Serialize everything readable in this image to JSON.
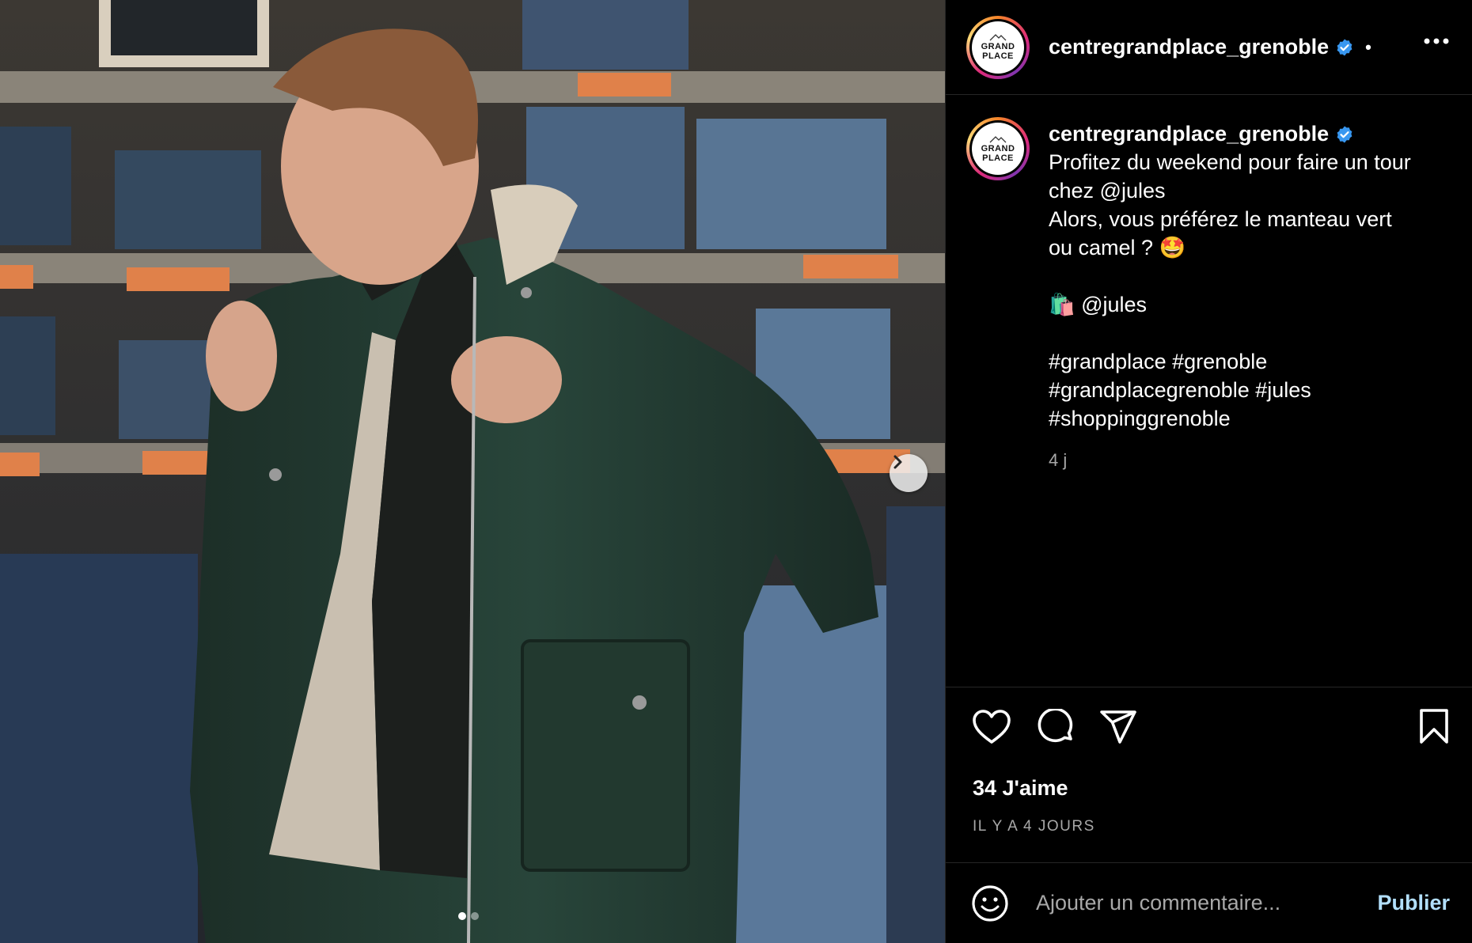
{
  "post": {
    "username": "centregrandplace_grenoble",
    "separator": "•",
    "avatar": {
      "line1": "GRAND",
      "line2": "PLACE"
    },
    "caption": "Profitez du weekend pour faire un tour chez @jules\nAlors, vous préférez le manteau vert ou camel ? 🤩\n\n🛍️ @jules\n\n#grandplace #grenoble #grandplacegrenoble #jules #shoppinggrenoble",
    "caption_time": "4 j",
    "likes": "34 J'aime",
    "date": "IL Y A 4 JOURS"
  },
  "comment": {
    "placeholder": "Ajouter un commentaire...",
    "publish_label": "Publier"
  },
  "icons": {
    "verified": "verified-badge-icon",
    "more": "more-options-icon",
    "like": "heart-icon",
    "comment": "comment-bubble-icon",
    "share": "paper-plane-icon",
    "save": "bookmark-icon",
    "emoji": "smiley-icon",
    "next": "chevron-right-icon"
  },
  "colors": {
    "background": "#000000",
    "secondary_text": "#a8a8a8",
    "verified": "#3897f0",
    "publish": "#b2dffc",
    "divider": "#262626"
  },
  "carousel": {
    "slides": 2,
    "active": 1
  }
}
